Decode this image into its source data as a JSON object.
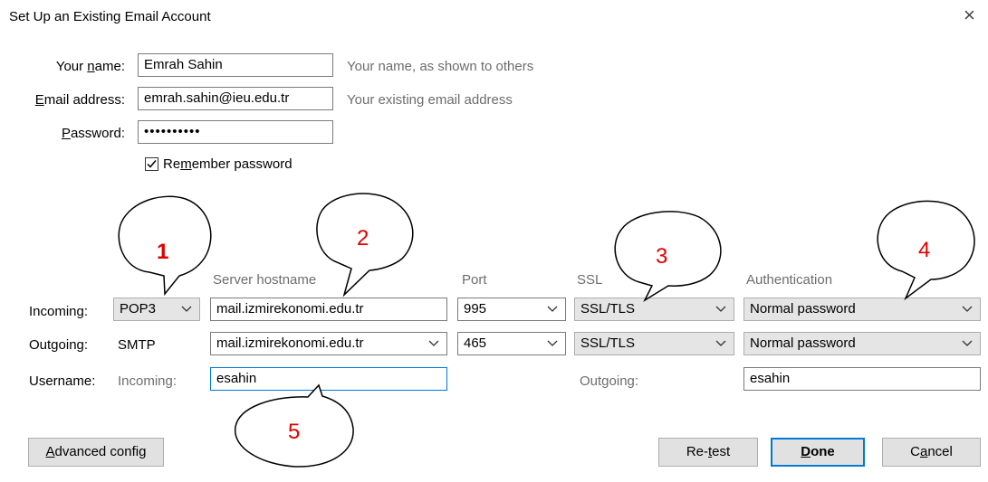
{
  "window": {
    "title": "Set Up an Existing Email Account",
    "close_glyph": "×"
  },
  "account": {
    "name_label_pre": "Your ",
    "name_label_key": "n",
    "name_label_post": "ame:",
    "name_value": "Emrah Sahin",
    "name_hint": "Your name, as shown to others",
    "email_label_key": "E",
    "email_label_post": "mail address:",
    "email_value": "emrah.sahin@ieu.edu.tr",
    "email_hint": "Your existing email address",
    "password_label_key": "P",
    "password_label_post": "assword:",
    "password_value": "••••••••••",
    "remember_pre": "Re",
    "remember_key": "m",
    "remember_post": "ember password",
    "remember_checked": true
  },
  "columns": {
    "hostname": "Server hostname",
    "port": "Port",
    "ssl": "SSL",
    "auth": "Authentication"
  },
  "incoming": {
    "label": "Incoming:",
    "protocol": "POP3",
    "hostname": "mail.izmirekonomi.edu.tr",
    "port": "995",
    "ssl": "SSL/TLS",
    "auth": "Normal password"
  },
  "outgoing": {
    "label": "Outgoing:",
    "protocol": "SMTP",
    "hostname": "mail.izmirekonomi.edu.tr",
    "port": "465",
    "ssl": "SSL/TLS",
    "auth": "Normal password"
  },
  "username": {
    "label": "Username:",
    "incoming_label": "Incoming:",
    "incoming_value": "esahin",
    "outgoing_label": "Outgoing:",
    "outgoing_value": "esahin"
  },
  "buttons": {
    "advanced_key": "A",
    "advanced_post": "dvanced config",
    "retest_pre": "Re-",
    "retest_key": "t",
    "retest_post": "est",
    "done_key": "D",
    "done_post": "one",
    "cancel_pre": "C",
    "cancel_key": "a",
    "cancel_post": "ncel"
  },
  "callouts": [
    "1",
    "2",
    "3",
    "4",
    "5"
  ],
  "colors": {
    "callout_text": "#e00000",
    "focus_border": "#0078d7"
  }
}
